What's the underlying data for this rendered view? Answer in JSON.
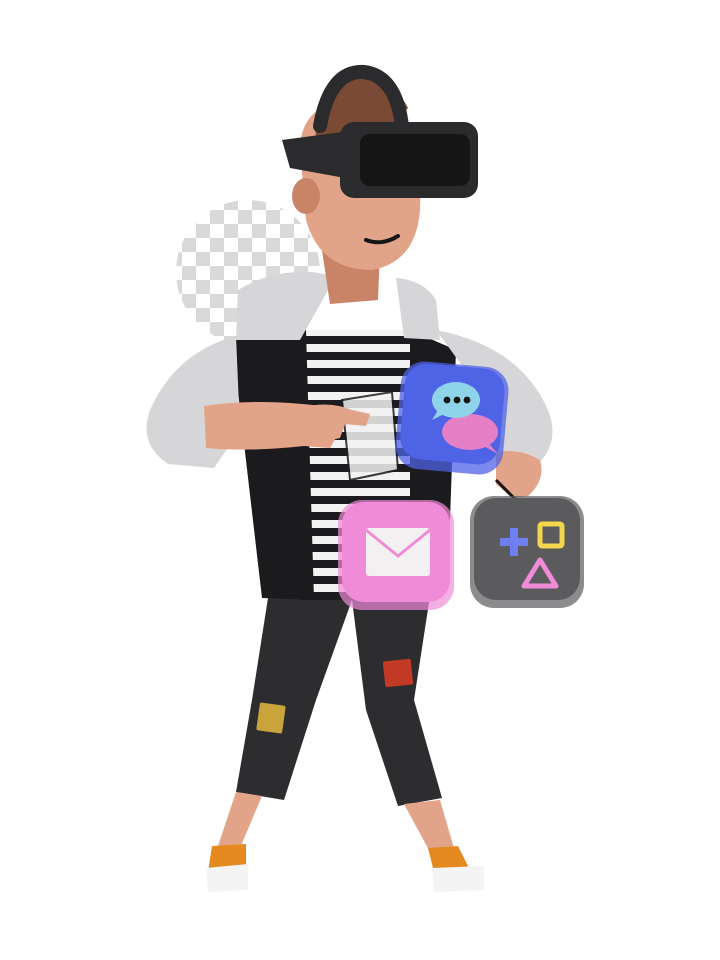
{
  "image": {
    "subject": "person-with-vr-headset",
    "background_color": "#ffffff"
  },
  "colors": {
    "skin": "#e2a488",
    "skin_shadow": "#c98366",
    "hair": "#7a4a34",
    "headset": "#2b2b2d",
    "headset_dark": "#151516",
    "hoodie_grey": "#d6d6d8",
    "hoodie_grey_shadow": "#a9a9ac",
    "vest_black": "#1b1b1d",
    "stripe_dark": "#1c1c1e",
    "stripe_light": "#f2f2f2",
    "pants": "#2d2d30",
    "patch_red": "#c23a26",
    "patch_yellow": "#c9a43a",
    "shoe_orange": "#e58a1f",
    "shoe_white": "#f4f4f4",
    "chat_icon_bg": "#4f63e6",
    "chat_bubble_cyan": "#8fd3e8",
    "chat_bubble_pink": "#e57fc6",
    "mail_icon_bg": "#f08bd8",
    "mail_envelope": "#f3f0f2",
    "game_icon_bg": "#5b5b5e",
    "game_plus": "#6f7ff0",
    "game_square": "#f2d64b",
    "game_triangle": "#f08bd8",
    "checker_light": "#ffffff",
    "checker_dark": "#d9d9d9"
  },
  "icons": {
    "chat": "chat-bubbles-icon",
    "mail": "mail-envelope-icon",
    "game": "game-shapes-icon",
    "transparency": "transparency-checkerboard-icon"
  }
}
